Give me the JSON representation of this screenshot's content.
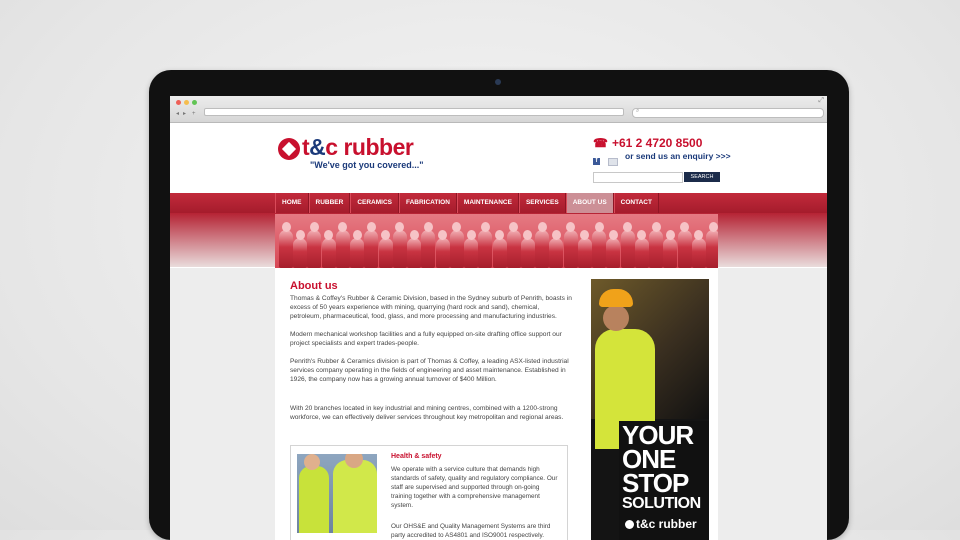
{
  "browser": {
    "back_icon": "◂",
    "forward_icon": "▸",
    "new_tab": "+",
    "search_glyph": "⌕",
    "expand_icon": "⤢"
  },
  "header": {
    "logo_text_a": "t",
    "logo_text_amp": "&",
    "logo_text_b": "c rubber",
    "tagline": "\"We've got you covered...\"",
    "phone_icon": "☎",
    "phone": "+61 2 4720 8500",
    "facebook": "f",
    "enquiry": "or send us an enquiry >>>",
    "search_button": "SEARCH"
  },
  "nav": {
    "items": [
      "HOME",
      "RUBBER",
      "CERAMICS",
      "FABRICATION",
      "MAINTENANCE",
      "SERVICES",
      "ABOUT US",
      "CONTACT"
    ],
    "active": "ABOUT US"
  },
  "main": {
    "title": "About us",
    "paragraphs": [
      "Thomas & Coffey's Rubber & Ceramic Division, based in the Sydney suburb of Penrith, boasts in excess of 50 years experience with mining, quarrying (hard rock and sand), chemical, petroleum, pharmaceutical, food, glass, and more processing and manufacturing industries.",
      "Modern mechanical workshop facilities and a fully equipped on-site drafting office support our project specialists and expert trades-people.",
      "Penrith's Rubber & Ceramics division is part of Thomas & Coffey, a leading ASX-listed industrial services company operating in the fields of engineering and asset maintenance. Established in 1926, the company now has a growing annual turnover of $400 Million.",
      "With 20 branches located in key industrial and mining centres, combined with a 1200-strong workforce, we can effectively deliver services throughout key metropolitan and regional areas."
    ],
    "health_safety": {
      "title": "Health & safety",
      "text1": "We operate with a service culture that demands high standards of safety, quality and regulatory compliance. Our staff are supervised and supported through on-going training together with a comprehensive management system.",
      "text2": "Our OHS&E and Quality Management Systems are third party accredited to AS4801 and ISO9001 respectively."
    }
  },
  "ad": {
    "line1": "YOUR",
    "line2": "ONE",
    "line3": "STOP",
    "line4": "SOLUTION",
    "logo": "t&c rubber"
  }
}
